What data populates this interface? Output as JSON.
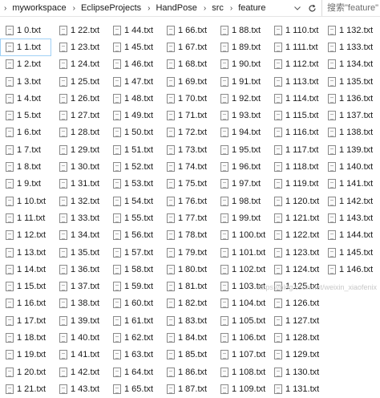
{
  "address_bar": {
    "breadcrumbs": [
      "myworkspace",
      "EclipseProjects",
      "HandPose",
      "src",
      "feature"
    ],
    "dropdown_icon": "chevron-down-icon",
    "refresh_icon": "refresh-icon"
  },
  "search": {
    "placeholder": "搜索\"feature\""
  },
  "file_icon": "text-file-icon",
  "selected_file": "1 1.txt",
  "columns": [
    [
      "1 0.txt",
      "1 1.txt",
      "1 2.txt",
      "1 3.txt",
      "1 4.txt",
      "1 5.txt",
      "1 6.txt",
      "1 7.txt",
      "1 8.txt",
      "1 9.txt",
      "1 10.txt",
      "1 11.txt",
      "1 12.txt",
      "1 13.txt",
      "1 14.txt",
      "1 15.txt",
      "1 16.txt",
      "1 17.txt",
      "1 18.txt",
      "1 19.txt",
      "1 20.txt",
      "1 21.txt"
    ],
    [
      "1 22.txt",
      "1 23.txt",
      "1 24.txt",
      "1 25.txt",
      "1 26.txt",
      "1 27.txt",
      "1 28.txt",
      "1 29.txt",
      "1 30.txt",
      "1 31.txt",
      "1 32.txt",
      "1 33.txt",
      "1 34.txt",
      "1 35.txt",
      "1 36.txt",
      "1 37.txt",
      "1 38.txt",
      "1 39.txt",
      "1 40.txt",
      "1 41.txt",
      "1 42.txt",
      "1 43.txt"
    ],
    [
      "1 44.txt",
      "1 45.txt",
      "1 46.txt",
      "1 47.txt",
      "1 48.txt",
      "1 49.txt",
      "1 50.txt",
      "1 51.txt",
      "1 52.txt",
      "1 53.txt",
      "1 54.txt",
      "1 55.txt",
      "1 56.txt",
      "1 57.txt",
      "1 58.txt",
      "1 59.txt",
      "1 60.txt",
      "1 61.txt",
      "1 62.txt",
      "1 63.txt",
      "1 64.txt",
      "1 65.txt"
    ],
    [
      "1 66.txt",
      "1 67.txt",
      "1 68.txt",
      "1 69.txt",
      "1 70.txt",
      "1 71.txt",
      "1 72.txt",
      "1 73.txt",
      "1 74.txt",
      "1 75.txt",
      "1 76.txt",
      "1 77.txt",
      "1 78.txt",
      "1 79.txt",
      "1 80.txt",
      "1 81.txt",
      "1 82.txt",
      "1 83.txt",
      "1 84.txt",
      "1 85.txt",
      "1 86.txt",
      "1 87.txt"
    ],
    [
      "1 88.txt",
      "1 89.txt",
      "1 90.txt",
      "1 91.txt",
      "1 92.txt",
      "1 93.txt",
      "1 94.txt",
      "1 95.txt",
      "1 96.txt",
      "1 97.txt",
      "1 98.txt",
      "1 99.txt",
      "1 100.txt",
      "1 101.txt",
      "1 102.txt",
      "1 103.txt",
      "1 104.txt",
      "1 105.txt",
      "1 106.txt",
      "1 107.txt",
      "1 108.txt",
      "1 109.txt"
    ],
    [
      "1 110.txt",
      "1 111.txt",
      "1 112.txt",
      "1 113.txt",
      "1 114.txt",
      "1 115.txt",
      "1 116.txt",
      "1 117.txt",
      "1 118.txt",
      "1 119.txt",
      "1 120.txt",
      "1 121.txt",
      "1 122.txt",
      "1 123.txt",
      "1 124.txt",
      "1 125.txt",
      "1 126.txt",
      "1 127.txt",
      "1 128.txt",
      "1 129.txt",
      "1 130.txt",
      "1 131.txt"
    ],
    [
      "1 132.txt",
      "1 133.txt",
      "1 134.txt",
      "1 135.txt",
      "1 136.txt",
      "1 137.txt",
      "1 138.txt",
      "1 139.txt",
      "1 140.txt",
      "1 141.txt",
      "1 142.txt",
      "1 143.txt",
      "1 144.txt",
      "1 145.txt",
      "1 146.txt"
    ]
  ],
  "watermark": "https://blog.csdn.net/weixin_xiaofenix"
}
